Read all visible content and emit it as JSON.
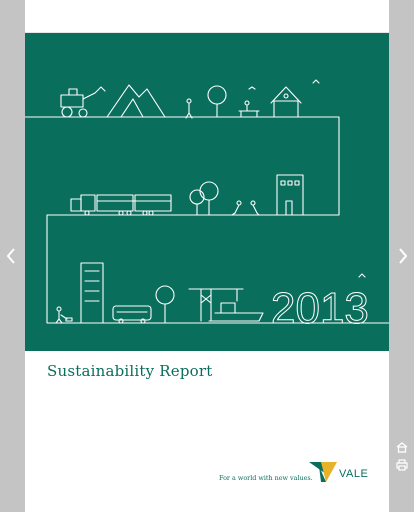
{
  "viewer": {
    "prev_icon": "chevron-left-icon",
    "next_icon": "chevron-right-icon",
    "home_icon": "home-icon",
    "print_icon": "print-icon"
  },
  "cover": {
    "year": "2013",
    "title": "Sustainability Report",
    "tagline": "For a world with new values.",
    "brand": "VALE",
    "colors": {
      "brand_green": "#0a6e5d",
      "logo_yellow": "#e8b229",
      "line_white": "#ffffff"
    }
  }
}
